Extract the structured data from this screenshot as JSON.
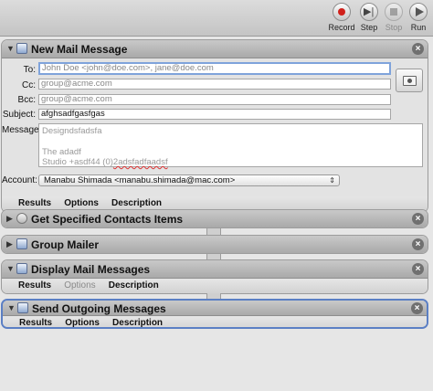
{
  "toolbar": {
    "record": "Record",
    "step": "Step",
    "stop": "Stop",
    "run": "Run"
  },
  "mail": {
    "title": "New Mail Message",
    "to_label": "To:",
    "to_placeholder": "John Doe <john@doe.com>, jane@doe.com",
    "cc_label": "Cc:",
    "cc_placeholder": "group@acme.com",
    "bcc_label": "Bcc:",
    "bcc_placeholder": "group@acme.com",
    "subject_label": "Subject:",
    "subject_value": "afghsadfgasfgas",
    "message_label": "Message:",
    "message_line1": "Designdsfadsfa",
    "message_line2": "The adadf",
    "message_line3a": "Studio +asdf44 (0)",
    "message_line3b": "2adsfadfaadsf",
    "account_label": "Account:",
    "account_value": "Manabu Shimada <manabu.shimada@mac.com>"
  },
  "footer_tabs": {
    "results": "Results",
    "options": "Options",
    "description": "Description"
  },
  "actions": {
    "contacts": "Get Specified Contacts Items",
    "group": "Group Mailer",
    "display": "Display Mail Messages",
    "send": "Send Outgoing Messages"
  }
}
